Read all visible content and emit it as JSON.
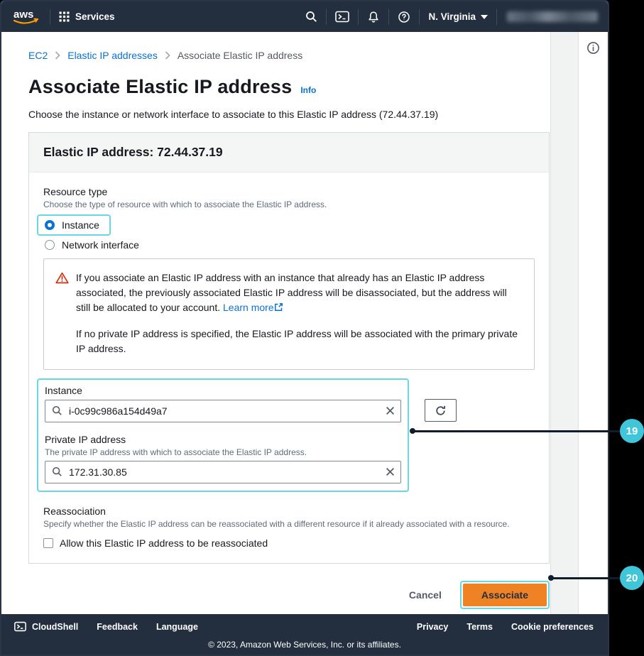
{
  "topbar": {
    "logo": "aws",
    "services_label": "Services",
    "region_label": "N. Virginia"
  },
  "breadcrumb": {
    "items": [
      "EC2",
      "Elastic IP addresses",
      "Associate Elastic IP address"
    ]
  },
  "page": {
    "title": "Associate Elastic IP address",
    "info_link_label": "Info",
    "description": "Choose the instance or network interface to associate to this Elastic IP address (72.44.37.19)"
  },
  "form_card": {
    "header_title": "Elastic IP address: 72.44.37.19",
    "resource_type": {
      "label": "Resource type",
      "help_text": "Choose the type of resource with which to associate the Elastic IP address.",
      "options": [
        {
          "label": "Instance",
          "selected": true
        },
        {
          "label": "Network interface",
          "selected": false
        }
      ]
    },
    "warning": {
      "paragraph1": "If you associate an Elastic IP address with an instance that already has an Elastic IP address associated, the previously associated Elastic IP address will be disassociated, but the address will still be allocated to your account.",
      "learn_more_label": "Learn more",
      "paragraph2": "If no private IP address is specified, the Elastic IP address will be associated with the primary private IP address."
    },
    "instance_field": {
      "label": "Instance",
      "value": "i-0c99c986a154d49a7"
    },
    "private_ip_field": {
      "label": "Private IP address",
      "help_text": "The private IP address with which to associate the Elastic IP address.",
      "value": "172.31.30.85"
    },
    "reassociation": {
      "label": "Reassociation",
      "help_text": "Specify whether the Elastic IP address can be reassociated with a different resource if it already associated with a resource.",
      "checkbox_label": "Allow this Elastic IP address to be reassociated",
      "checked": false
    }
  },
  "actions": {
    "cancel_label": "Cancel",
    "associate_label": "Associate"
  },
  "footer": {
    "cloudshell_label": "CloudShell",
    "feedback_label": "Feedback",
    "language_label": "Language",
    "privacy_label": "Privacy",
    "terms_label": "Terms",
    "cookie_label": "Cookie preferences",
    "copyright": "© 2023, Amazon Web Services, Inc. or its affiliates."
  },
  "callouts": {
    "badge_19": "19",
    "badge_20": "20"
  },
  "colors": {
    "topbar_bg": "#232f3e",
    "link_blue": "#0972d3",
    "warning_red": "#d13212",
    "highlight_cyan": "#69d6e3",
    "badge_cyan": "#3fc6d8",
    "primary_orange": "#ee8225"
  }
}
